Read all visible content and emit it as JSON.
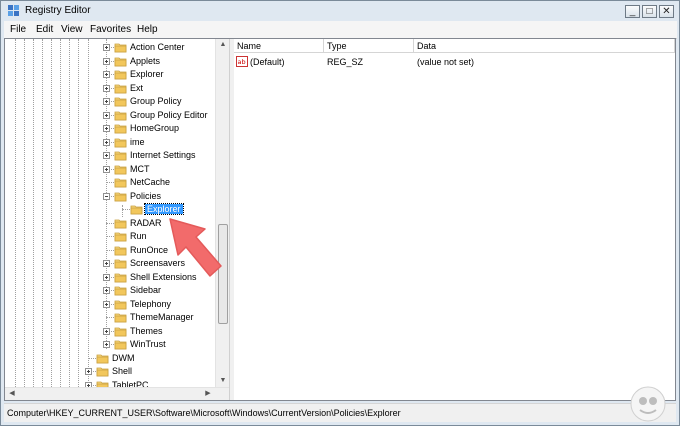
{
  "window": {
    "title": "Registry Editor",
    "controls": {
      "minimize": "_",
      "maximize": "□",
      "close": "✕"
    }
  },
  "menu": [
    "File",
    "Edit",
    "View",
    "Favorites",
    "Help"
  ],
  "tree": {
    "items": [
      {
        "label": "Action Center",
        "level": 2,
        "expander": "plus"
      },
      {
        "label": "Applets",
        "level": 2,
        "expander": "plus"
      },
      {
        "label": "Explorer",
        "level": 2,
        "expander": "plus"
      },
      {
        "label": "Ext",
        "level": 2,
        "expander": "plus"
      },
      {
        "label": "Group Policy",
        "level": 2,
        "expander": "plus"
      },
      {
        "label": "Group Policy Editor",
        "level": 2,
        "expander": "plus"
      },
      {
        "label": "HomeGroup",
        "level": 2,
        "expander": "plus"
      },
      {
        "label": "ime",
        "level": 2,
        "expander": "plus"
      },
      {
        "label": "Internet Settings",
        "level": 2,
        "expander": "plus"
      },
      {
        "label": "MCT",
        "level": 2,
        "expander": "plus"
      },
      {
        "label": "NetCache",
        "level": 2,
        "expander": "none"
      },
      {
        "label": "Policies",
        "level": 2,
        "expander": "minus"
      },
      {
        "label": "Explorer",
        "level": 3,
        "expander": "none",
        "selected": true
      },
      {
        "label": "RADAR",
        "level": 2,
        "expander": "none"
      },
      {
        "label": "Run",
        "level": 2,
        "expander": "none"
      },
      {
        "label": "RunOnce",
        "level": 2,
        "expander": "none"
      },
      {
        "label": "Screensavers",
        "level": 2,
        "expander": "plus"
      },
      {
        "label": "Shell Extensions",
        "level": 2,
        "expander": "plus"
      },
      {
        "label": "Sidebar",
        "level": 2,
        "expander": "plus"
      },
      {
        "label": "Telephony",
        "level": 2,
        "expander": "plus"
      },
      {
        "label": "ThemeManager",
        "level": 2,
        "expander": "none"
      },
      {
        "label": "Themes",
        "level": 2,
        "expander": "plus"
      },
      {
        "label": "WinTrust",
        "level": 2,
        "expander": "plus"
      },
      {
        "label": "DWM",
        "level": 1,
        "expander": "none"
      },
      {
        "label": "Shell",
        "level": 1,
        "expander": "plus"
      },
      {
        "label": "TabletPC",
        "level": 1,
        "expander": "plus"
      }
    ]
  },
  "list": {
    "columns": [
      "Name",
      "Type",
      "Data"
    ],
    "rows": [
      {
        "name": "(Default)",
        "type": "REG_SZ",
        "data": "(value not set)"
      }
    ]
  },
  "status": {
    "path": "Computer\\HKEY_CURRENT_USER\\Software\\Microsoft\\Windows\\CurrentVersion\\Policies\\Explorer"
  },
  "colors": {
    "selection": "#3399ff",
    "folder": "#f2c75c",
    "arrow": "#f26b6b"
  },
  "icons": {
    "app": "registry-editor-icon",
    "folder": "folder-icon",
    "value": "string-value-icon",
    "annotation": "arrow-icon"
  }
}
